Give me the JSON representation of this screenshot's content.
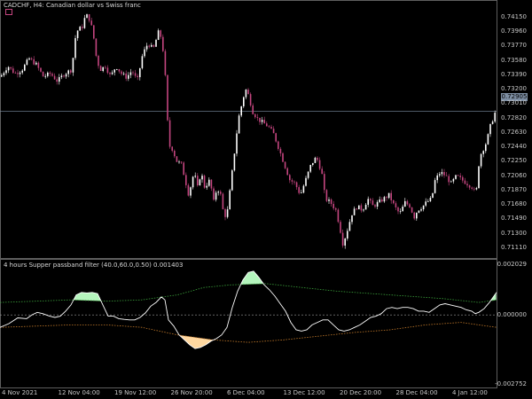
{
  "window": {
    "symbol_title": "CADCHF, H4:  Canadian dollar vs Swiss franc",
    "indicator_title": "4 hours Supper passband filter (40.0,60.0,0.50) 0.001403"
  },
  "colors": {
    "background": "#000000",
    "candle_bull": "#ffffff",
    "candle_bear": "#c4457f",
    "grid": "#5e5e5e",
    "filter_line": "#ffffff",
    "upper_band": "#3aa03a",
    "lower_band": "#c47a2a",
    "fill_up": "#b5f5bd",
    "fill_down": "#ffd8a0"
  },
  "chart_data": [
    {
      "type": "candlestick",
      "title": "CADCHF, H4:  Canadian dollar vs Swiss franc",
      "ylim": [
        0.7098,
        0.743
      ],
      "y_ticks": [
        "0.74150",
        "0.73960",
        "0.73770",
        "0.73580",
        "0.73390",
        "0.73200",
        "0.73010",
        "0.72820",
        "0.72630",
        "0.72440",
        "0.72250",
        "0.72060",
        "0.71870",
        "0.71680",
        "0.71490",
        "0.71300",
        "0.71110"
      ],
      "current_price": "0.72905",
      "current_price_value": 0.72905,
      "x_ticks": [
        "4 Nov 2021",
        "12 Nov 04:00",
        "19 Nov 12:00",
        "26 Nov 20:00",
        "6 Dec 04:00",
        "13 Dec 12:00",
        "20 Dec 20:00",
        "28 Dec 04:00",
        "4 Jan 12:00"
      ],
      "close_path": [
        [
          0,
          0.7336
        ],
        [
          8,
          0.735
        ],
        [
          16,
          0.734
        ],
        [
          24,
          0.7345
        ],
        [
          32,
          0.736
        ],
        [
          40,
          0.7352
        ],
        [
          48,
          0.7336
        ],
        [
          56,
          0.734
        ],
        [
          64,
          0.733
        ],
        [
          72,
          0.734
        ],
        [
          80,
          0.7345
        ],
        [
          85,
          0.7395
        ],
        [
          92,
          0.7402
        ],
        [
          96,
          0.7418
        ],
        [
          100,
          0.7412
        ],
        [
          104,
          0.7395
        ],
        [
          108,
          0.736
        ],
        [
          112,
          0.7345
        ],
        [
          118,
          0.735
        ],
        [
          124,
          0.7336
        ],
        [
          130,
          0.735
        ],
        [
          136,
          0.734
        ],
        [
          142,
          0.7335
        ],
        [
          148,
          0.7344
        ],
        [
          154,
          0.733
        ],
        [
          160,
          0.7365
        ],
        [
          166,
          0.738
        ],
        [
          172,
          0.7372
        ],
        [
          178,
          0.7395
        ],
        [
          182,
          0.7385
        ],
        [
          186,
          0.733
        ],
        [
          188,
          0.728
        ],
        [
          190,
          0.7245
        ],
        [
          194,
          0.724
        ],
        [
          198,
          0.7225
        ],
        [
          204,
          0.722
        ],
        [
          208,
          0.72
        ],
        [
          212,
          0.718
        ],
        [
          218,
          0.721
        ],
        [
          222,
          0.719
        ],
        [
          226,
          0.721
        ],
        [
          230,
          0.719
        ],
        [
          236,
          0.72
        ],
        [
          240,
          0.717
        ],
        [
          244,
          0.719
        ],
        [
          248,
          0.718
        ],
        [
          252,
          0.715
        ],
        [
          256,
          0.716
        ],
        [
          260,
          0.72
        ],
        [
          264,
          0.724
        ],
        [
          268,
          0.728
        ],
        [
          272,
          0.73
        ],
        [
          276,
          0.732
        ],
        [
          280,
          0.731
        ],
        [
          284,
          0.729
        ],
        [
          290,
          0.728
        ],
        [
          296,
          0.7275
        ],
        [
          302,
          0.727
        ],
        [
          308,
          0.726
        ],
        [
          314,
          0.724
        ],
        [
          320,
          0.722
        ],
        [
          326,
          0.72
        ],
        [
          332,
          0.7195
        ],
        [
          338,
          0.718
        ],
        [
          344,
          0.72
        ],
        [
          350,
          0.722
        ],
        [
          356,
          0.723
        ],
        [
          362,
          0.721
        ],
        [
          366,
          0.7175
        ],
        [
          372,
          0.717
        ],
        [
          378,
          0.716
        ],
        [
          382,
          0.714
        ],
        [
          386,
          0.7115
        ],
        [
          390,
          0.713
        ],
        [
          396,
          0.7155
        ],
        [
          402,
          0.7165
        ],
        [
          408,
          0.716
        ],
        [
          414,
          0.7175
        ],
        [
          420,
          0.7165
        ],
        [
          426,
          0.717
        ],
        [
          432,
          0.7175
        ],
        [
          438,
          0.718
        ],
        [
          444,
          0.7165
        ],
        [
          450,
          0.7155
        ],
        [
          456,
          0.717
        ],
        [
          462,
          0.7165
        ],
        [
          466,
          0.715
        ],
        [
          470,
          0.716
        ],
        [
          476,
          0.7165
        ],
        [
          480,
          0.717
        ],
        [
          486,
          0.7175
        ],
        [
          490,
          0.72
        ],
        [
          496,
          0.721
        ],
        [
          502,
          0.7205
        ],
        [
          508,
          0.7195
        ],
        [
          514,
          0.7205
        ],
        [
          520,
          0.72
        ],
        [
          526,
          0.7195
        ],
        [
          532,
          0.719
        ],
        [
          536,
          0.718
        ],
        [
          540,
          0.723
        ],
        [
          544,
          0.724
        ],
        [
          548,
          0.725
        ],
        [
          552,
          0.727
        ],
        [
          558,
          0.729
        ]
      ]
    },
    {
      "type": "line",
      "title": "4 hours Supper passband filter (40.0,60.0,0.50) 0.001403",
      "ylim": [
        -0.0028,
        0.0021
      ],
      "y_ticks": [
        "0.002029",
        "0.000000",
        "-0.002752"
      ],
      "series": [
        {
          "role": "filter",
          "points": [
            [
              0,
              -0.0005
            ],
            [
              10,
              -0.00035
            ],
            [
              20,
              -0.00012
            ],
            [
              30,
              -0.00015
            ],
            [
              36,
              0.0
            ],
            [
              42,
              0.0001
            ],
            [
              48,
              5e-05
            ],
            [
              56,
              -5e-05
            ],
            [
              62,
              -0.0001
            ],
            [
              68,
              -5e-05
            ],
            [
              74,
              0.00015
            ],
            [
              80,
              0.0004
            ],
            [
              86,
              0.0008
            ],
            [
              92,
              0.0009
            ],
            [
              98,
              0.00088
            ],
            [
              104,
              0.0009
            ],
            [
              110,
              0.00085
            ],
            [
              116,
              0.0004
            ],
            [
              122,
              -5e-05
            ],
            [
              128,
              -5e-05
            ],
            [
              134,
              -0.00015
            ],
            [
              140,
              -0.00018
            ],
            [
              146,
              -0.0002
            ],
            [
              152,
              -0.0002
            ],
            [
              158,
              -0.0001
            ],
            [
              164,
              8e-05
            ],
            [
              170,
              0.00035
            ],
            [
              176,
              0.0005
            ],
            [
              182,
              0.00072
            ],
            [
              186,
              0.0006
            ],
            [
              190,
              -0.0002
            ],
            [
              196,
              -0.00045
            ],
            [
              202,
              -0.0008
            ],
            [
              208,
              -0.001
            ],
            [
              214,
              -0.0012
            ],
            [
              220,
              -0.00135
            ],
            [
              226,
              -0.0013
            ],
            [
              232,
              -0.0012
            ],
            [
              238,
              -0.00105
            ],
            [
              244,
              -0.00095
            ],
            [
              250,
              -0.0008
            ],
            [
              256,
              -0.0005
            ],
            [
              262,
              0.0003
            ],
            [
              268,
              0.00095
            ],
            [
              274,
              0.0014
            ],
            [
              280,
              0.0017
            ],
            [
              286,
              0.00175
            ],
            [
              292,
              0.0015
            ],
            [
              298,
              0.0012
            ],
            [
              304,
              0.001
            ],
            [
              310,
              0.00075
            ],
            [
              316,
              0.00045
            ],
            [
              322,
              0.00015
            ],
            [
              328,
              -0.0003
            ],
            [
              334,
              -0.0006
            ],
            [
              340,
              -0.00065
            ],
            [
              346,
              -0.0006
            ],
            [
              352,
              -0.0004
            ],
            [
              358,
              -0.0003
            ],
            [
              364,
              -0.0002
            ],
            [
              370,
              -0.0002
            ],
            [
              376,
              -0.0004
            ],
            [
              382,
              -0.0006
            ],
            [
              388,
              -0.00065
            ],
            [
              394,
              -0.0006
            ],
            [
              400,
              -0.0005
            ],
            [
              406,
              -0.0004
            ],
            [
              412,
              -0.00025
            ],
            [
              418,
              -0.0001
            ],
            [
              424,
              -5e-05
            ],
            [
              430,
              5e-05
            ],
            [
              436,
              0.00025
            ],
            [
              442,
              0.0003
            ],
            [
              448,
              0.00025
            ],
            [
              454,
              0.0003
            ],
            [
              460,
              0.0003
            ],
            [
              466,
              0.00025
            ],
            [
              472,
              0.00015
            ],
            [
              478,
              0.00015
            ],
            [
              484,
              0.0001
            ],
            [
              490,
              0.00025
            ],
            [
              496,
              0.0004
            ],
            [
              502,
              0.00045
            ],
            [
              508,
              0.0004
            ],
            [
              514,
              0.00035
            ],
            [
              520,
              0.0003
            ],
            [
              526,
              0.0002
            ],
            [
              532,
              0.00015
            ],
            [
              536,
              5e-05
            ],
            [
              540,
              0.0001
            ],
            [
              546,
              0.00025
            ],
            [
              552,
              0.0005
            ],
            [
              556,
              0.0007
            ],
            [
              560,
              0.0009
            ]
          ]
        },
        {
          "role": "upper_band",
          "points": [
            [
              0,
              0.0005
            ],
            [
              40,
              0.00055
            ],
            [
              80,
              0.0006
            ],
            [
              120,
              0.00055
            ],
            [
              160,
              0.0006
            ],
            [
              200,
              0.0008
            ],
            [
              230,
              0.0011
            ],
            [
              260,
              0.0012
            ],
            [
              300,
              0.00125
            ],
            [
              340,
              0.0011
            ],
            [
              380,
              0.00095
            ],
            [
              420,
              0.00085
            ],
            [
              460,
              0.00075
            ],
            [
              500,
              0.00065
            ],
            [
              540,
              0.0005
            ],
            [
              560,
              0.0006
            ]
          ]
        },
        {
          "role": "lower_band",
          "points": [
            [
              0,
              -0.0005
            ],
            [
              40,
              -0.00045
            ],
            [
              80,
              -0.0004
            ],
            [
              120,
              -0.0004
            ],
            [
              160,
              -0.0005
            ],
            [
              200,
              -0.0008
            ],
            [
              240,
              -0.001
            ],
            [
              280,
              -0.0011
            ],
            [
              320,
              -0.001
            ],
            [
              360,
              -0.00085
            ],
            [
              400,
              -0.0007
            ],
            [
              440,
              -0.0006
            ],
            [
              480,
              -0.0004
            ],
            [
              520,
              -0.0003
            ],
            [
              560,
              -0.0005
            ]
          ]
        }
      ]
    }
  ]
}
